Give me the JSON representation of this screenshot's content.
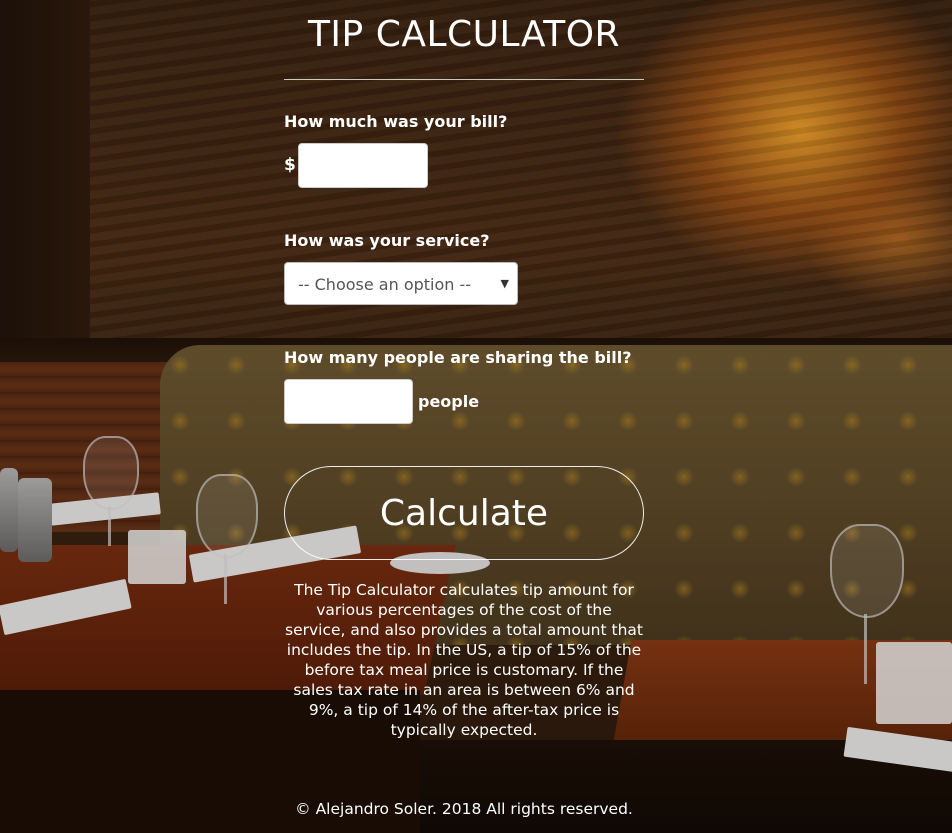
{
  "app": {
    "title": "TIP CALCULATOR"
  },
  "bill": {
    "label": "How much was your bill?",
    "currency_symbol": "$",
    "value": "",
    "placeholder": ""
  },
  "service": {
    "label": "How was your service?",
    "selected_option": "-- Choose an option --"
  },
  "people": {
    "label": "How many people are sharing the bill?",
    "value": "",
    "placeholder": "",
    "suffix": "people"
  },
  "calculate_button": {
    "label": "Calculate"
  },
  "description": "The Tip Calculator calculates tip amount for various percentages of the cost of the service, and also provides a total amount that includes the tip. In the US, a tip of 15% of the before tax meal price is customary. If the sales tax rate in an area is between 6% and 9%, a tip of 14% of the after-tax price is typically expected.",
  "footer": {
    "copyright": "© Alejandro Soler. 2018 All rights reserved."
  },
  "colors": {
    "text": "#ffffff",
    "input_background": "#ffffff",
    "button_border": "#ffffff"
  },
  "icons": {
    "select_caret": "caret-down-icon"
  }
}
